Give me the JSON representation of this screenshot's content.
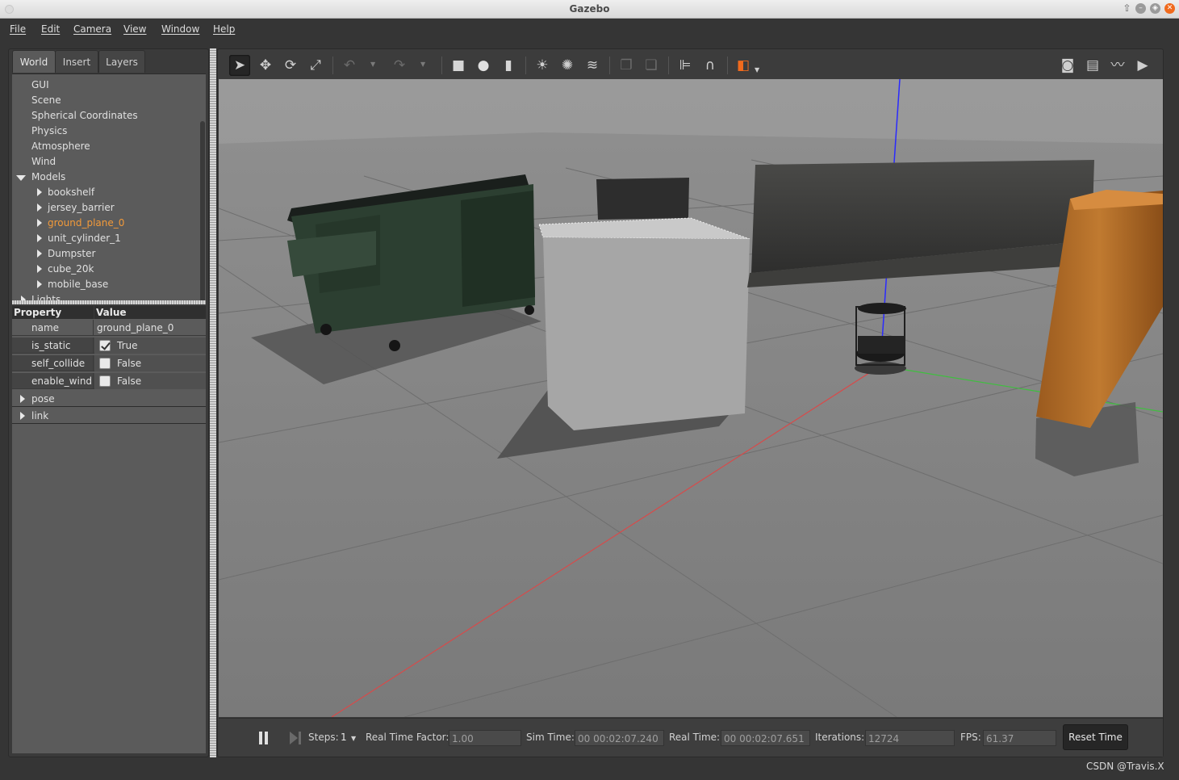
{
  "window": {
    "title": "Gazebo"
  },
  "menu": [
    "File",
    "Edit",
    "Camera",
    "View",
    "Window",
    "Help"
  ],
  "left_tabs": [
    "World",
    "Insert",
    "Layers"
  ],
  "tree": {
    "items": [
      "GUI",
      "Scene",
      "Spherical Coordinates",
      "Physics",
      "Atmosphere",
      "Wind"
    ],
    "models_label": "Models",
    "models": [
      "bookshelf",
      "jersey_barrier",
      "ground_plane_0",
      "unit_cylinder_1",
      "Dumpster",
      "cube_20k",
      "mobile_base"
    ],
    "selected": "ground_plane_0",
    "lights_label": "Lights"
  },
  "properties": {
    "header_property": "Property",
    "header_value": "Value",
    "rows": [
      {
        "name": "name",
        "value": "ground_plane_0"
      },
      {
        "name": "is_static",
        "value": "True"
      },
      {
        "name": "self_collide",
        "value": "False"
      },
      {
        "name": "enable_wind",
        "value": "False"
      }
    ],
    "groups": [
      "pose",
      "link"
    ]
  },
  "toolbar_icons": [
    "select-arrow-icon",
    "translate-icon",
    "rotate-icon",
    "scale-icon",
    "undo-icon",
    "redo-icon",
    "box-icon",
    "sphere-icon",
    "cylinder-icon",
    "point-light-icon",
    "spot-light-icon",
    "directional-light-icon",
    "copy-icon",
    "paste-icon",
    "align-icon",
    "snap-magnet-icon",
    "view-angle-icon",
    "screenshot-icon",
    "log-icon",
    "plot-icon",
    "video-record-icon"
  ],
  "timebar": {
    "steps_label": "Steps:",
    "steps_value": "1",
    "rtf_label": "Real Time Factor:",
    "rtf_value": "1.00",
    "sim_label": "Sim Time:",
    "sim_value": "00 00:02:07.240",
    "real_label": "Real Time:",
    "real_value": "00 00:02:07.651",
    "iter_label": "Iterations:",
    "iter_value": "12724",
    "fps_label": "FPS:",
    "fps_value": "61.37",
    "reset_label": "Reset Time"
  },
  "watermark": "CSDN @Travis.X",
  "colors": {
    "accent": "#f06a1d",
    "selected_text": "#f29a3a",
    "x_axis": "#d84a4a",
    "y_axis": "#3fbf3f",
    "z_axis": "#2a2aff"
  }
}
